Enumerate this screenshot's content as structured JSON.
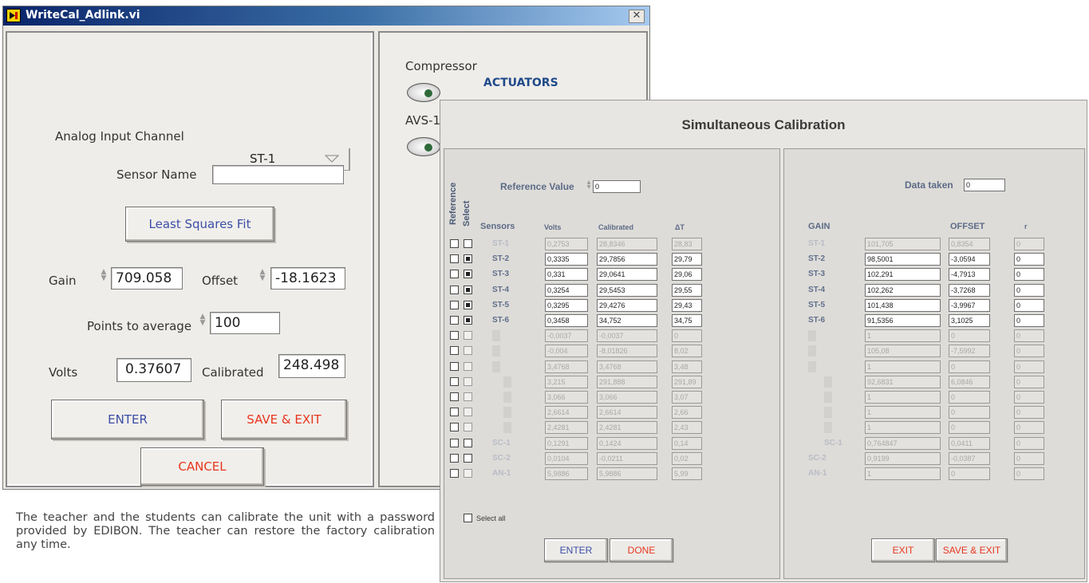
{
  "window1": {
    "title": "WriteCal_Adlink.vi",
    "close_glyph": "✕",
    "analog_input_label": "Analog Input Channel",
    "analog_input_value": "ST-1",
    "sensor_name_label": "Sensor Name",
    "sensor_name_value": "",
    "least_squares_button": "Least Squares  Fit",
    "gain_label": "Gain",
    "gain_value": "709.058",
    "offset_label": "Offset",
    "offset_value": "-18.1623",
    "points_label": "Points to average",
    "points_value": "100",
    "volts_label": "Volts",
    "volts_value": "0.37607",
    "calibrated_label": "Calibrated",
    "calibrated_value": "248.498",
    "enter_button": "ENTER",
    "save_exit_button": "SAVE & EXIT",
    "cancel_button": "CANCEL",
    "compressor_label": "Compressor",
    "actuators_label": "ACTUATORS",
    "avs_label": "AVS-1"
  },
  "caption": "The teacher and the students can calibrate the unit with a password provided by EDIBON. The teacher can restore the factory calibration any time.",
  "window2": {
    "title": "Simultaneous Calibration",
    "reference_label": "Reference",
    "select_label": "Select",
    "reference_value_label": "Reference Value",
    "reference_value": "0",
    "data_taken_label": "Data taken",
    "data_taken_value": "0",
    "columns_left": [
      "Sensors",
      "Volts",
      "Calibrated",
      "ΔT"
    ],
    "columns_right": [
      "GAIN",
      "OFFSET",
      "r"
    ],
    "rows": [
      {
        "sensor": "ST-1",
        "selected": false,
        "volts": "0,2753",
        "calibrated": "28,8346",
        "dt": "28,83",
        "rsensor": "ST-1",
        "gain": "101,705",
        "offset": "0,8354",
        "r": "0",
        "active": false
      },
      {
        "sensor": "ST-2",
        "selected": true,
        "volts": "0,3335",
        "calibrated": "29,7856",
        "dt": "29,79",
        "rsensor": "ST-2",
        "gain": "98,5001",
        "offset": "-3,0594",
        "r": "0",
        "active": true
      },
      {
        "sensor": "ST-3",
        "selected": true,
        "volts": "0,331",
        "calibrated": "29,0641",
        "dt": "29,06",
        "rsensor": "ST-3",
        "gain": "102,291",
        "offset": "-4,7913",
        "r": "0",
        "active": true
      },
      {
        "sensor": "ST-4",
        "selected": true,
        "volts": "0,3254",
        "calibrated": "29,5453",
        "dt": "29,55",
        "rsensor": "ST-4",
        "gain": "102,262",
        "offset": "-3,7268",
        "r": "0",
        "active": true
      },
      {
        "sensor": "ST-5",
        "selected": true,
        "volts": "0,3295",
        "calibrated": "29,4276",
        "dt": "29,43",
        "rsensor": "ST-5",
        "gain": "101,438",
        "offset": "-3,9967",
        "r": "0",
        "active": true
      },
      {
        "sensor": "ST-6",
        "selected": true,
        "volts": "0,3458",
        "calibrated": "34,752",
        "dt": "34,75",
        "rsensor": "ST-6",
        "gain": "91,5356",
        "offset": "3,1025",
        "r": "0",
        "active": true
      },
      {
        "sensor": "",
        "selected": false,
        "volts": "-0,0037",
        "calibrated": "-0,0037",
        "dt": "0",
        "rsensor": "",
        "gain": "1",
        "offset": "0",
        "r": "0",
        "active": false
      },
      {
        "sensor": "",
        "selected": false,
        "volts": "-0,004",
        "calibrated": "-8,01826",
        "dt": "8,02",
        "rsensor": "",
        "gain": "105,08",
        "offset": "-7,5992",
        "r": "0",
        "active": false
      },
      {
        "sensor": "",
        "selected": false,
        "volts": "3,4768",
        "calibrated": "3,4768",
        "dt": "3,48",
        "rsensor": "",
        "gain": "1",
        "offset": "0",
        "r": "0",
        "active": false
      },
      {
        "sensor": "",
        "selected": false,
        "volts": "3,215",
        "calibrated": "291,888",
        "dt": "291,89",
        "rsensor": "",
        "gain": "92,6831",
        "offset": "6,0846",
        "r": "0",
        "active": false
      },
      {
        "sensor": "",
        "selected": false,
        "volts": "3,066",
        "calibrated": "3,066",
        "dt": "3,07",
        "rsensor": "",
        "gain": "1",
        "offset": "0",
        "r": "0",
        "active": false
      },
      {
        "sensor": "",
        "selected": false,
        "volts": "2,6614",
        "calibrated": "2,6614",
        "dt": "2,66",
        "rsensor": "",
        "gain": "1",
        "offset": "0",
        "r": "0",
        "active": false
      },
      {
        "sensor": "",
        "selected": false,
        "volts": "2,4281",
        "calibrated": "2,4281",
        "dt": "2,43",
        "rsensor": "",
        "gain": "1",
        "offset": "0",
        "r": "0",
        "active": false
      },
      {
        "sensor": "SC-1",
        "selected": false,
        "volts": "0,1291",
        "calibrated": "0,1424",
        "dt": "0,14",
        "rsensor": "SC-1",
        "gain": "0,764847",
        "offset": "0,0411",
        "r": "0",
        "active": false
      },
      {
        "sensor": "SC-2",
        "selected": false,
        "volts": "0,0104",
        "calibrated": "-0,0211",
        "dt": "0,02",
        "rsensor": "SC-2",
        "gain": "0,9199",
        "offset": "-0,0387",
        "r": "0",
        "active": false
      },
      {
        "sensor": "AN-1",
        "selected": false,
        "volts": "5,9886",
        "calibrated": "5,9886",
        "dt": "5,99",
        "rsensor": "AN-1",
        "gain": "1",
        "offset": "0",
        "r": "0",
        "active": false
      }
    ],
    "select_all_label": "Select all",
    "enter_button": "ENTER",
    "done_button": "DONE",
    "exit_button": "EXIT",
    "save_exit_button": "SAVE & EXIT"
  },
  "colors": {
    "label_blue": "#5f6f8c",
    "button_red": "#e8361e",
    "button_blue": "#3b4ea6",
    "titlebar": "#0a246a"
  },
  "icons": [
    "labview-vi-icon",
    "close-icon",
    "dropdown-arrow-icon",
    "spinner-icon",
    "led-indicator-icon"
  ]
}
